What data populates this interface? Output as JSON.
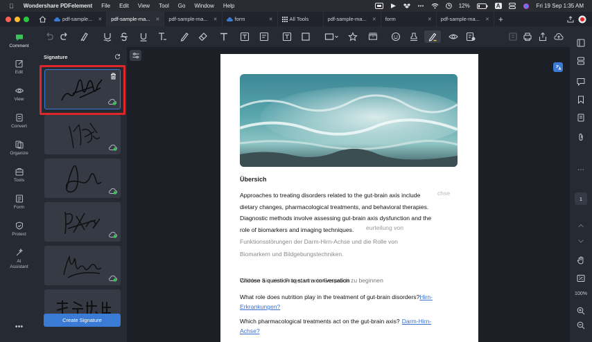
{
  "menubar": {
    "app": "Wondershare PDFelement",
    "items": [
      "File",
      "Edit",
      "View",
      "Tool",
      "Go",
      "Window",
      "Help"
    ],
    "battery": "12%",
    "input": "A",
    "datetime": "Fri 19 Sep  1:35 AM"
  },
  "tabs": [
    {
      "label": "pdf-sample..."
    },
    {
      "label": "pdf-sample-ma..."
    },
    {
      "label": "pdf-sample-ma..."
    },
    {
      "label": "form"
    },
    {
      "label": "All Tools"
    },
    {
      "label": "pdf-sample-ma..."
    },
    {
      "label": "form"
    },
    {
      "label": "pdf-sample-ma..."
    }
  ],
  "rail": [
    {
      "label": "Comment"
    },
    {
      "label": "Edit"
    },
    {
      "label": "View"
    },
    {
      "label": "Convert"
    },
    {
      "label": "Organize"
    },
    {
      "label": "Tools"
    },
    {
      "label": "Form"
    },
    {
      "label": "Protect"
    },
    {
      "label": "AI"
    },
    {
      "label": "Assistant"
    }
  ],
  "panel": {
    "title": "Signature",
    "create_label": "Create Signature"
  },
  "doc": {
    "heading": "Übersich",
    "para_en": [
      "Approaches to treating disorders related to the gut-brain axis include",
      "dietary changes, pharmacological treatments, and behavioral therapies.",
      "Diagnostic methods involve assessing gut-brain axis dysfunction and the",
      "role of biomarkers and imaging techniques."
    ],
    "para_de_tail": [
      "Funktionsstörungen der Darm-Hirn-Achse und die Rolle von",
      "Biomarkern und Bildgebungstechniken."
    ],
    "ghost_frag1": "chse",
    "ghost_frag2": "eurteilung von",
    "q_heading": "Choose a question to start a conversation",
    "q_heading_ghost": "Wählen Sie eine Frage, um ein Gespräch zu beginnen",
    "q1": "What role does nutrition play in the treatment of gut-brain disorders?",
    "q1_tail_link": "Hirn-",
    "q1_line2": "Erkrankungen?",
    "q2": "Which pharmacological treatments act on the gut-brain axis?",
    "q2_tail_link": "Darm-Hirn-",
    "q2_line2": "Achse?"
  },
  "rrail": {
    "page": "1",
    "zoom": "100%"
  },
  "colors": {
    "accent": "#3a7bd5",
    "highlight": "#e0262b",
    "cloud": "#3cc25a",
    "link": "#3a6fd0"
  }
}
